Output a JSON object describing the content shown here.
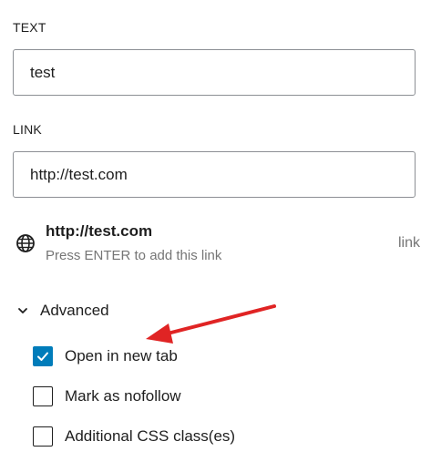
{
  "text_field": {
    "label": "TEXT",
    "value": "test"
  },
  "link_field": {
    "label": "LINK",
    "value": "http://test.com"
  },
  "suggestion": {
    "icon": "globe-icon",
    "title": "http://test.com",
    "hint": "Press ENTER to add this link",
    "type": "link"
  },
  "advanced": {
    "label": "Advanced",
    "expanded": true,
    "options": [
      {
        "label": "Open in new tab",
        "checked": true
      },
      {
        "label": "Mark as nofollow",
        "checked": false
      },
      {
        "label": "Additional CSS class(es)",
        "checked": false
      }
    ]
  },
  "colors": {
    "checkbox_checked": "#007cba",
    "annotation_arrow": "#e02424"
  }
}
